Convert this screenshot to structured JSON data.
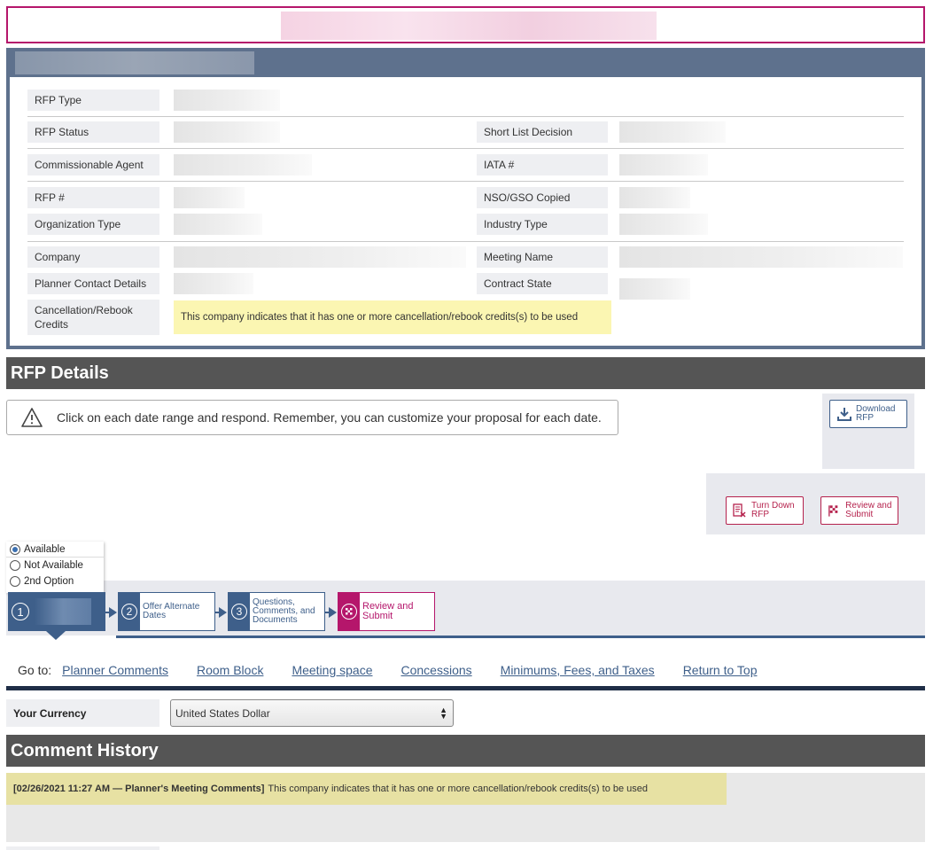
{
  "colors": {
    "accent": "#3e5f8a",
    "brand": "#b5166b",
    "header": "#555555",
    "note": "#fbf6b2"
  },
  "info": {
    "rows": [
      {
        "left_label": "RFP Type"
      },
      {
        "left_label": "RFP Status",
        "right_label": "Short List Decision"
      },
      {
        "left_label": "Commissionable Agent",
        "right_label": "IATA #"
      },
      {
        "left_label": "RFP #",
        "right_label": "NSO/GSO Copied"
      },
      {
        "left_label": "Organization Type",
        "right_label": "Industry Type"
      },
      {
        "left_label": "Company",
        "right_label": "Meeting Name"
      },
      {
        "left_label": "Planner Contact Details",
        "right_label": "Contract State"
      },
      {
        "left_label": "Cancellation/Rebook Credits"
      }
    ],
    "credit_note": "This company indicates that it has one or more cancellation/rebook credits(s) to be used"
  },
  "rfp_details": {
    "title": "RFP Details",
    "alert_text": "Click on each date range and respond. Remember, you can customize your proposal for each date.",
    "download_label": "Download RFP",
    "turn_down_label": "Turn Down RFP",
    "review_submit_label": "Review and Submit"
  },
  "availability": {
    "options": [
      "Available",
      "Not Available",
      "2nd Option"
    ],
    "selected": "Available"
  },
  "steps": [
    {
      "num": "1",
      "label": ""
    },
    {
      "num": "2",
      "label": "Offer Alternate Dates"
    },
    {
      "num": "3",
      "label": "Questions, Comments, and Documents"
    },
    {
      "num": "",
      "label": "Review and Submit"
    }
  ],
  "goto": {
    "label": "Go to:",
    "links": [
      "Planner Comments",
      "Room Block",
      "Meeting space",
      "Concessions",
      "Minimums, Fees, and Taxes",
      "Return to Top"
    ]
  },
  "currency": {
    "label": "Your Currency",
    "selected": "United States Dollar"
  },
  "comment_history": {
    "title": "Comment History",
    "entries": [
      {
        "meta": "[02/26/2021 11:27 AM — Planner's Meeting Comments]",
        "text": "This company indicates that it has one or more cancellation/rebook credits(s) to be used"
      }
    ]
  }
}
